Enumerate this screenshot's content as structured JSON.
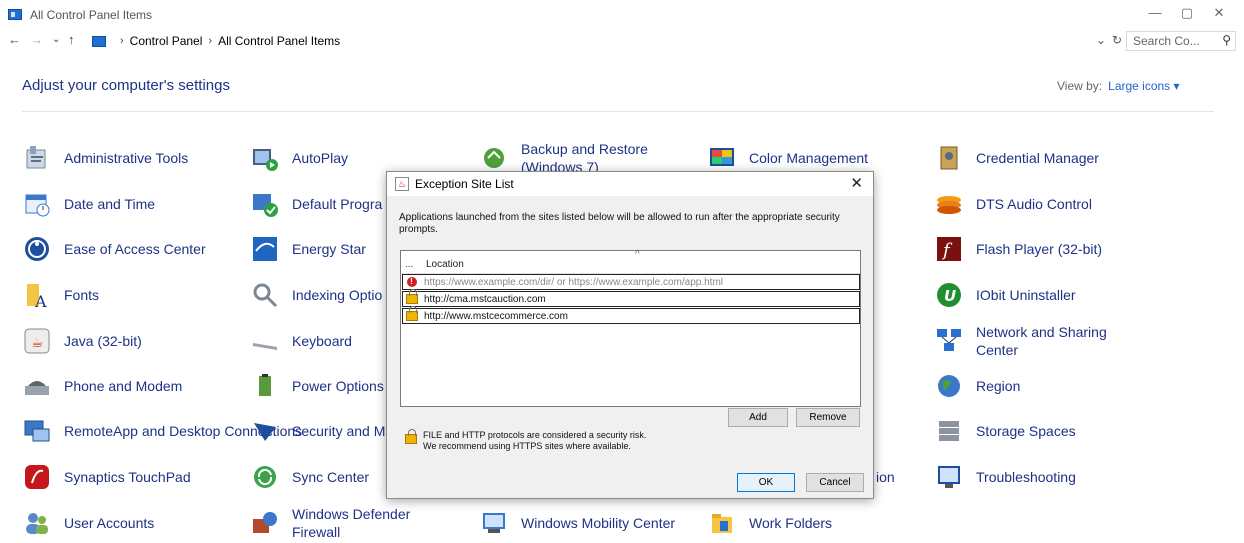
{
  "window": {
    "title": "All Control Panel Items",
    "minimize": "—",
    "maximize": "▢",
    "close": "✕"
  },
  "nav": {
    "back": "←",
    "forward": "→",
    "recent": "⌄",
    "up": "↑",
    "breadcrumb": [
      "Control Panel",
      "All Control Panel Items"
    ],
    "dropdown": "⌄",
    "refresh": "↻",
    "search_placeholder": "Search Co...",
    "search_icon": "⚲"
  },
  "content": {
    "heading": "Adjust your computer's settings",
    "view_by_label": "View by:",
    "view_by_value": "Large icons ▾"
  },
  "items": [
    {
      "label": "Administrative Tools",
      "icon": "admin-tools-icon"
    },
    {
      "label": "AutoPlay",
      "icon": "autoplay-icon"
    },
    {
      "label": "Backup and Restore (Windows 7)",
      "icon": "backup-icon"
    },
    {
      "label": "Color Management",
      "icon": "color-management-icon"
    },
    {
      "label": "Credential Manager",
      "icon": "credential-manager-icon"
    },
    {
      "label": "Date and Time",
      "icon": "date-time-icon"
    },
    {
      "label": "Default Progra",
      "icon": "default-programs-icon"
    },
    {
      "label": "DTS Audio Control",
      "icon": "dts-audio-icon"
    },
    {
      "label": "Ease of Access Center",
      "icon": "ease-of-access-icon"
    },
    {
      "label": "Energy Star",
      "icon": "energy-star-icon"
    },
    {
      "label": "Flash Player (32-bit)",
      "icon": "flash-player-icon"
    },
    {
      "label": "Fonts",
      "icon": "fonts-icon"
    },
    {
      "label": "Indexing Optio",
      "icon": "indexing-icon"
    },
    {
      "label": "IObit Uninstaller",
      "icon": "iobit-icon"
    },
    {
      "label": "Java (32-bit)",
      "icon": "java-icon"
    },
    {
      "label": "Keyboard",
      "icon": "keyboard-icon"
    },
    {
      "label": "Network and Sharing Center",
      "icon": "network-icon"
    },
    {
      "label": "Phone and Modem",
      "icon": "phone-modem-icon"
    },
    {
      "label": "Power Options",
      "icon": "power-options-icon"
    },
    {
      "label": "Region",
      "icon": "region-icon"
    },
    {
      "label": "RemoteApp and Desktop Connections",
      "icon": "remoteapp-icon"
    },
    {
      "label": "Security and M",
      "icon": "security-icon"
    },
    {
      "label": "Storage Spaces",
      "icon": "storage-spaces-icon"
    },
    {
      "label": "Synaptics TouchPad",
      "icon": "synaptics-icon"
    },
    {
      "label": "Sync Center",
      "icon": "sync-center-icon"
    },
    {
      "label": "ion",
      "icon": ""
    },
    {
      "label": "Troubleshooting",
      "icon": "troubleshooting-icon"
    },
    {
      "label": "User Accounts",
      "icon": "user-accounts-icon"
    },
    {
      "label": "Windows Defender Firewall",
      "icon": "firewall-icon"
    },
    {
      "label": "Windows Mobility Center",
      "icon": "mobility-center-icon"
    },
    {
      "label": "Work Folders",
      "icon": "work-folders-icon"
    }
  ],
  "dialog": {
    "title": "Exception Site List",
    "close": "✕",
    "description": "Applications launched from the sites listed below will be allowed to run after the appropriate security prompts.",
    "columns": {
      "first": "...",
      "location": "Location",
      "sort": "^"
    },
    "rows": [
      {
        "text": "https://www.example.com/dir/ or https://www.example.com/app.html",
        "icon": "error-icon",
        "badge": "!"
      },
      {
        "text": "http://cma.mstcauction.com",
        "icon": "unlocked-icon"
      },
      {
        "text": "http://www.mstcecommerce.com",
        "icon": "unlocked-icon"
      }
    ],
    "add": "Add",
    "remove": "Remove",
    "warning_line1": "FILE and HTTP protocols are considered a security risk.",
    "warning_line2": "We recommend using HTTPS sites where available.",
    "ok": "OK",
    "cancel": "Cancel"
  }
}
